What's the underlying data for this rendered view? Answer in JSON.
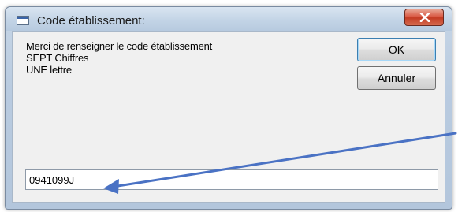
{
  "window": {
    "title": "Code établissement:",
    "icon": "window-app-icon",
    "close_icon": "close-icon"
  },
  "message": {
    "line1": "Merci de renseigner le code établissement",
    "line2": "SEPT Chiffres",
    "line3": "UNE lettre"
  },
  "buttons": {
    "ok_label": "OK",
    "cancel_label": "Annuler"
  },
  "input": {
    "value": "0941099J"
  },
  "annotation": {
    "arrow_color": "#4a72c4",
    "icon": "arrow-icon"
  }
}
